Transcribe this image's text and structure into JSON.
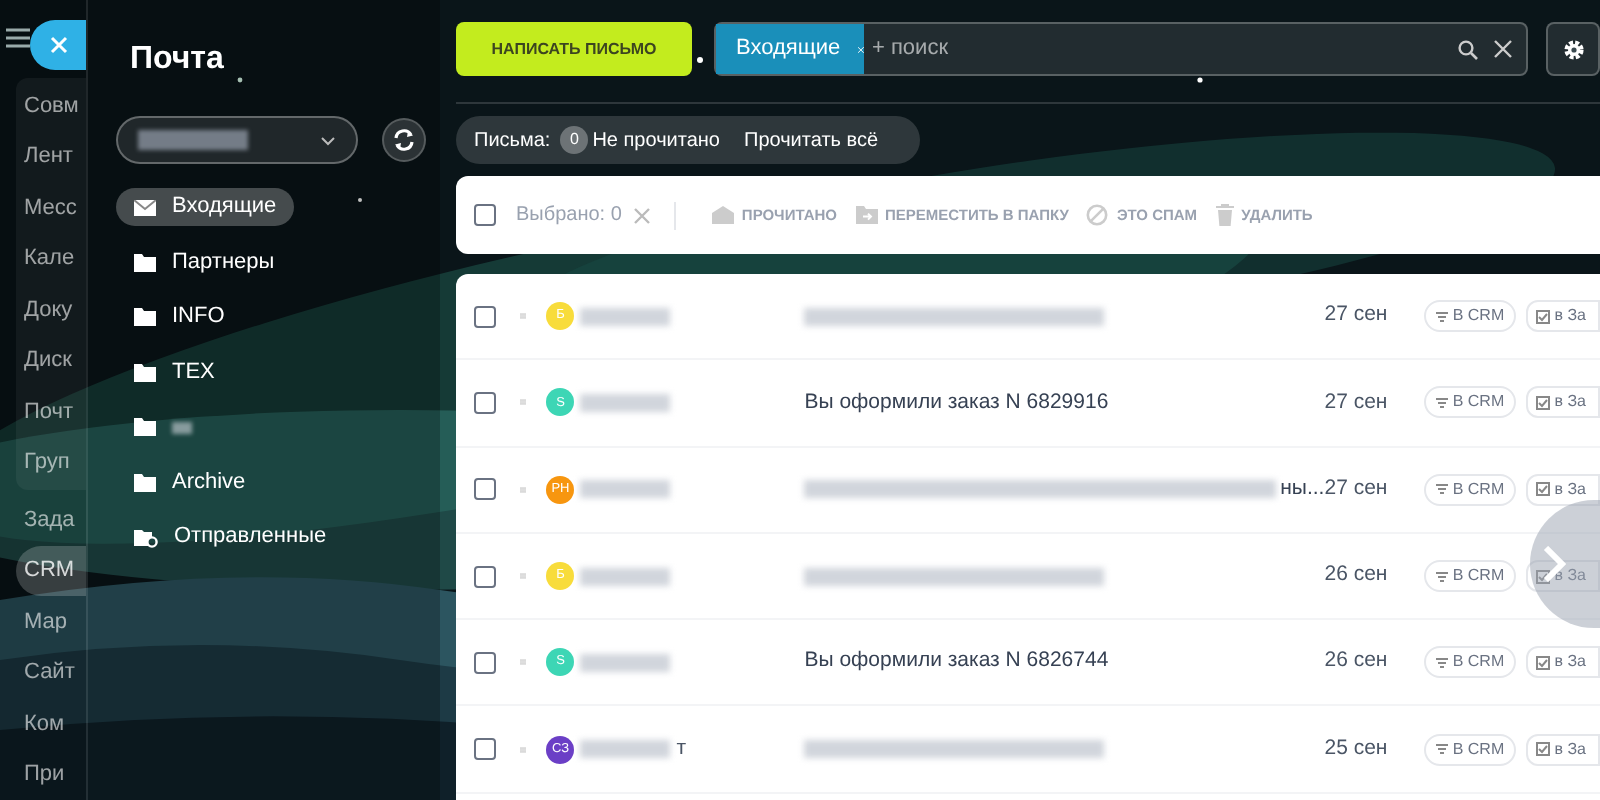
{
  "nav": {
    "items": [
      {
        "label": "Совм",
        "selected": false,
        "grouped": true
      },
      {
        "label": "Лент",
        "selected": false,
        "grouped": true
      },
      {
        "label": "Месс",
        "selected": false,
        "grouped": true
      },
      {
        "label": "Кале",
        "selected": false,
        "grouped": true
      },
      {
        "label": "Доку",
        "selected": false,
        "grouped": true
      },
      {
        "label": "Диск",
        "selected": false,
        "grouped": true
      },
      {
        "label": "Почт",
        "selected": false,
        "grouped": true
      },
      {
        "label": "Груп",
        "selected": false,
        "grouped": true
      },
      {
        "label": "Зада",
        "selected": false,
        "grouped": false
      },
      {
        "label": "CRM",
        "selected": true,
        "grouped": false
      },
      {
        "label": "Мар",
        "selected": false,
        "grouped": false
      },
      {
        "label": "Сайт",
        "selected": false,
        "grouped": false
      },
      {
        "label": "Ком",
        "selected": false,
        "grouped": false
      },
      {
        "label": "При",
        "selected": false,
        "grouped": false
      }
    ]
  },
  "mail_panel": {
    "title": "Почта",
    "folders": [
      {
        "kind": "inbox",
        "label": "Входящие",
        "selected": true
      },
      {
        "kind": "folder",
        "label": "Партнеры",
        "selected": false
      },
      {
        "kind": "folder",
        "label": "INFO",
        "selected": false
      },
      {
        "kind": "folder",
        "label": "TEX",
        "selected": false
      },
      {
        "kind": "folder",
        "redacted": true,
        "selected": false
      },
      {
        "kind": "folder",
        "label": "Archive",
        "selected": false
      },
      {
        "kind": "sent",
        "label": "Отправленные",
        "selected": false
      }
    ]
  },
  "compose_button": "НАПИСАТЬ ПИСЬМО",
  "search": {
    "tag": "Входящие",
    "placeholder": "+ поиск"
  },
  "counter": {
    "label": "Письма:",
    "count": "0",
    "unread": "Не прочитано",
    "read_all": "Прочитать всё"
  },
  "toolbar": {
    "select_all_checked": false,
    "selected_text": "Выбрано: 0",
    "actions": [
      {
        "kind": "read",
        "label": "ПРОЧИТАНО"
      },
      {
        "kind": "move",
        "label": "ПЕРЕМЕСТИТЬ В ПАПКУ"
      },
      {
        "kind": "spam",
        "label": "ЭТО СПАМ"
      },
      {
        "kind": "delete",
        "label": "УДАЛИТЬ"
      }
    ]
  },
  "messages": [
    {
      "checked": false,
      "avatar": "Б",
      "color": "#f8dc3b",
      "date": "27 сен",
      "crm_button": "В CRM",
      "task_button": "в За"
    },
    {
      "checked": false,
      "avatar": "S",
      "color": "#3dd6b5",
      "subject": "Вы оформили заказ N 6829916",
      "date": "27 сен",
      "crm_button": "В CRM",
      "task_button": "в За"
    },
    {
      "checked": false,
      "avatar": "PH",
      "color": "#f7960f",
      "subject_tail": "ны...",
      "date": "27 сен",
      "crm_button": "В CRM",
      "task_button": "в За"
    },
    {
      "checked": false,
      "avatar": "Б",
      "color": "#f8dc3b",
      "date": "26 сен",
      "crm_button": "В CRM",
      "task_button": "в За"
    },
    {
      "checked": false,
      "avatar": "S",
      "color": "#3dd6b5",
      "subject": "Вы оформили заказ N 6826744",
      "date": "26 сен",
      "crm_button": "В CRM",
      "task_button": "в За"
    },
    {
      "checked": false,
      "avatar": "СЗ",
      "color": "#6b3fc6",
      "sender_tail": "т",
      "date": "25 сен",
      "crm_button": "В CRM",
      "task_button": "в За"
    }
  ]
}
